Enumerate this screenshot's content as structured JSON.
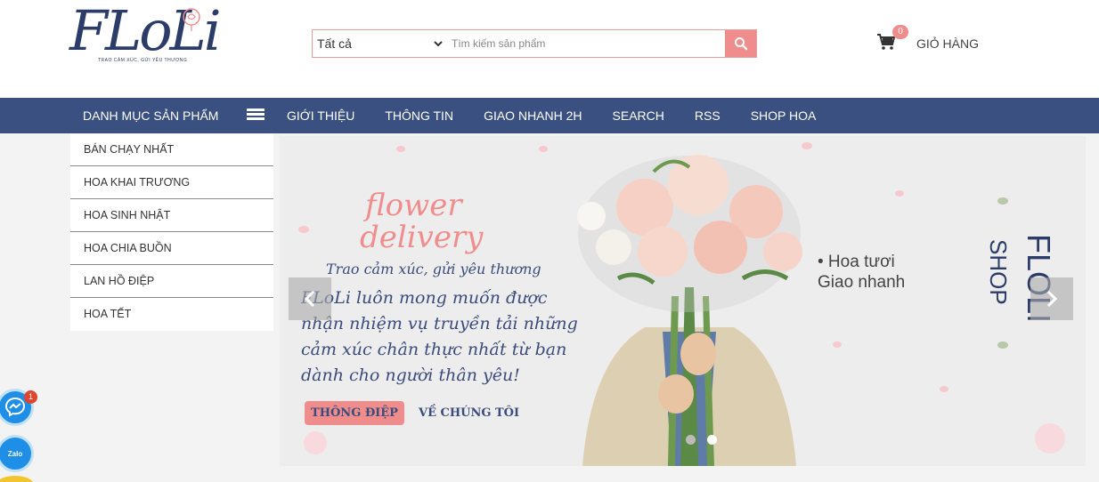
{
  "header": {
    "logo_text": "FLoLi",
    "logo_tagline": "TRAO CẢM XÚC, GỬI YÊU THƯƠNG",
    "search": {
      "category_selected": "Tất cả",
      "placeholder": "Tìm kiếm sản phẩm",
      "value": ""
    },
    "cart": {
      "count": "0",
      "label": "GIỎ HÀNG"
    }
  },
  "nav": {
    "category_label": "DANH MỤC SẢN PHẨM",
    "links": [
      "GIỚI THIỆU",
      "THÔNG TIN",
      "GIAO NHANH 2H",
      "SEARCH",
      "RSS",
      "SHOP HOA"
    ]
  },
  "sidebar": {
    "items": [
      "BÁN CHẠY NHẤT",
      "HOA KHAI TRƯƠNG",
      "HOA SINH NHẬT",
      "HOA CHIA BUỒN",
      "LAN HỒ ĐIỆP",
      "HOA TẾT"
    ]
  },
  "banner": {
    "script_title_line1": "flower",
    "script_title_line2": "delivery",
    "script_subtitle": "Trao cảm xúc, gửi yêu thương",
    "paragraph": "FLoLi luôn mong muốn được nhận nhiệm vụ truyền tải những cảm xúc chân thực nhất từ bạn dành cho người thân yêu!",
    "button_primary": "THÔNG ĐIỆP",
    "button_secondary": "VỀ CHÚNG TÔI",
    "bullet_line1": "• Hoa tươi",
    "bullet_line2": "Giao nhanh",
    "vertical_brand": "FLOLI",
    "vertical_sub": "SHOP",
    "slide_count": 2,
    "active_slide": 2
  },
  "floating": {
    "messenger_badge": "1",
    "zalo_label": "Zalo"
  },
  "colors": {
    "nav_bg": "#3a5080",
    "accent_pink": "#ef8d8d",
    "navy": "#3b4c7c"
  }
}
